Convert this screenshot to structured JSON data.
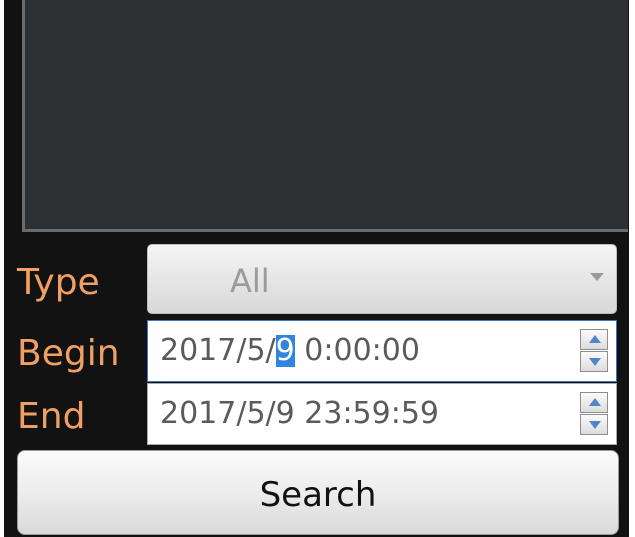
{
  "form": {
    "type_label": "Type",
    "type_value": "All",
    "begin_label": "Begin",
    "begin_value_prefix": "2017/5/",
    "begin_value_selected": "9",
    "begin_value_suffix": " 0:00:00",
    "end_label": "End",
    "end_value": "2017/5/9 23:59:59",
    "search_label": "Search"
  },
  "icons": {
    "type_dropdown": "chevron-down-icon",
    "spinner_up": "spin-up-icon",
    "spinner_down": "spin-down-icon"
  },
  "colors": {
    "background": "#121212",
    "label_text": "#f0a064",
    "selection_highlight": "#2f86de",
    "preview_background": "#2e3134"
  }
}
